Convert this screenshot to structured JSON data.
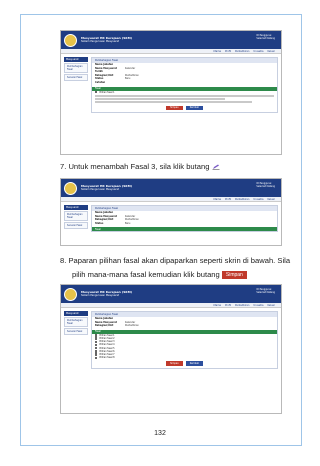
{
  "app": {
    "title_line1": "Mesyuarat HR Kerajaan (SKM)",
    "title_line2": "Sistem Pengurusan Mesyuarat",
    "user_line1": "ID Pengguna:",
    "user_line2": "Selamat Datang",
    "nav": [
      "Utama",
      "Profil",
      "Pentadbiran",
      "Urusetia",
      "Keluar"
    ]
  },
  "sidebar": {
    "heading": "Mesyuarat",
    "items": [
      "Pembahagian Fasal",
      "Senarai Fasal"
    ]
  },
  "form": {
    "heading": "Pembahagian Fasal",
    "fields": [
      {
        "k": "Nama Jabatan",
        "v": ""
      },
      {
        "k": "Nama Mesyuarat",
        "v": "Kalendar"
      },
      {
        "k": "Tarikh",
        "v": ""
      },
      {
        "k": "Bahagian/Unit",
        "v": "Pentadbiran"
      },
      {
        "k": "Status",
        "v": "Baru"
      },
      {
        "k": "Catatan",
        "v": ""
      }
    ],
    "section_label": "Fasal",
    "submit": "Simpan",
    "back": "Kembali"
  },
  "checklist": [
    "Pilihan fasal 1",
    "Pilihan fasal 2",
    "Pilihan fasal 3",
    "Pilihan fasal 4",
    "Pilihan fasal 5",
    "Pilihan fasal 6",
    "Pilihan fasal 7",
    "Pilihan fasal 8"
  ],
  "steps": {
    "step7": "7.  Untuk menambah Fasal 3, sila klik butang",
    "step8_line1": "8.  Paparan pilihan fasal akan dipaparkan seperti skrin di bawah. Sila",
    "step8_line2": "pilih mana-mana fasal kemudian klik butang",
    "step8_button": "Simpan"
  },
  "page_number": "132",
  "colors": {
    "header": "#1f3d83",
    "section": "#2d8a4a",
    "button_red": "#c0392b",
    "page_border": "#9fc5e8"
  }
}
